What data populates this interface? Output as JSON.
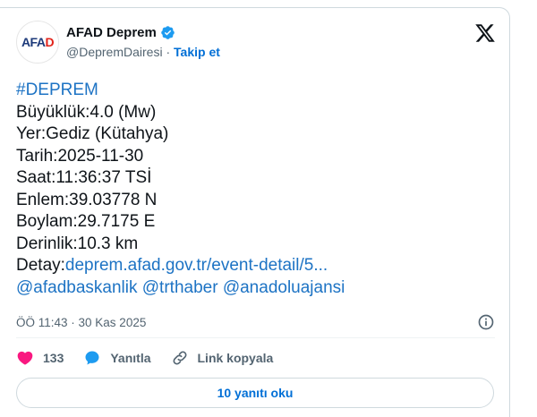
{
  "author": {
    "avatar_text_main": "AFA",
    "avatar_text_accent": "D",
    "display_name": "AFAD Deprem",
    "handle": "@DepremDairesi",
    "separator": " · ",
    "follow_label": "Takip et"
  },
  "tweet": {
    "hashtag": "#DEPREM",
    "lines": [
      "Büyüklük:4.0 (Mw)",
      "Yer:Gediz (Kütahya)",
      "Tarih:2025-11-30",
      "Saat:11:36:37 TSİ",
      "Enlem:39.03778 N",
      "Boylam:29.7175 E",
      "Derinlik:10.3 km"
    ],
    "detail_label": "Detay:",
    "detail_link": "deprem.afad.gov.tr/event-detail/5...",
    "mentions": [
      "@afadbaskanlik",
      "@trthaber",
      "@anadoluajansi"
    ]
  },
  "meta": {
    "timestamp": "ÖÖ 11:43 · 30 Kas 2025"
  },
  "actions": {
    "like_count": "133",
    "reply_label": "Yanıtla",
    "copy_link_label": "Link kopyala"
  },
  "replies_button": "10 yanıtı oku",
  "colors": {
    "link": "#1d73c4",
    "follow": "#006fd6",
    "like_heart": "#f91880",
    "reply_bubble": "#1d9bf0",
    "verified": "#1d9bf0"
  },
  "icons": [
    "verified-badge-icon",
    "x-logo-icon",
    "info-icon",
    "heart-icon",
    "reply-icon",
    "link-icon"
  ]
}
